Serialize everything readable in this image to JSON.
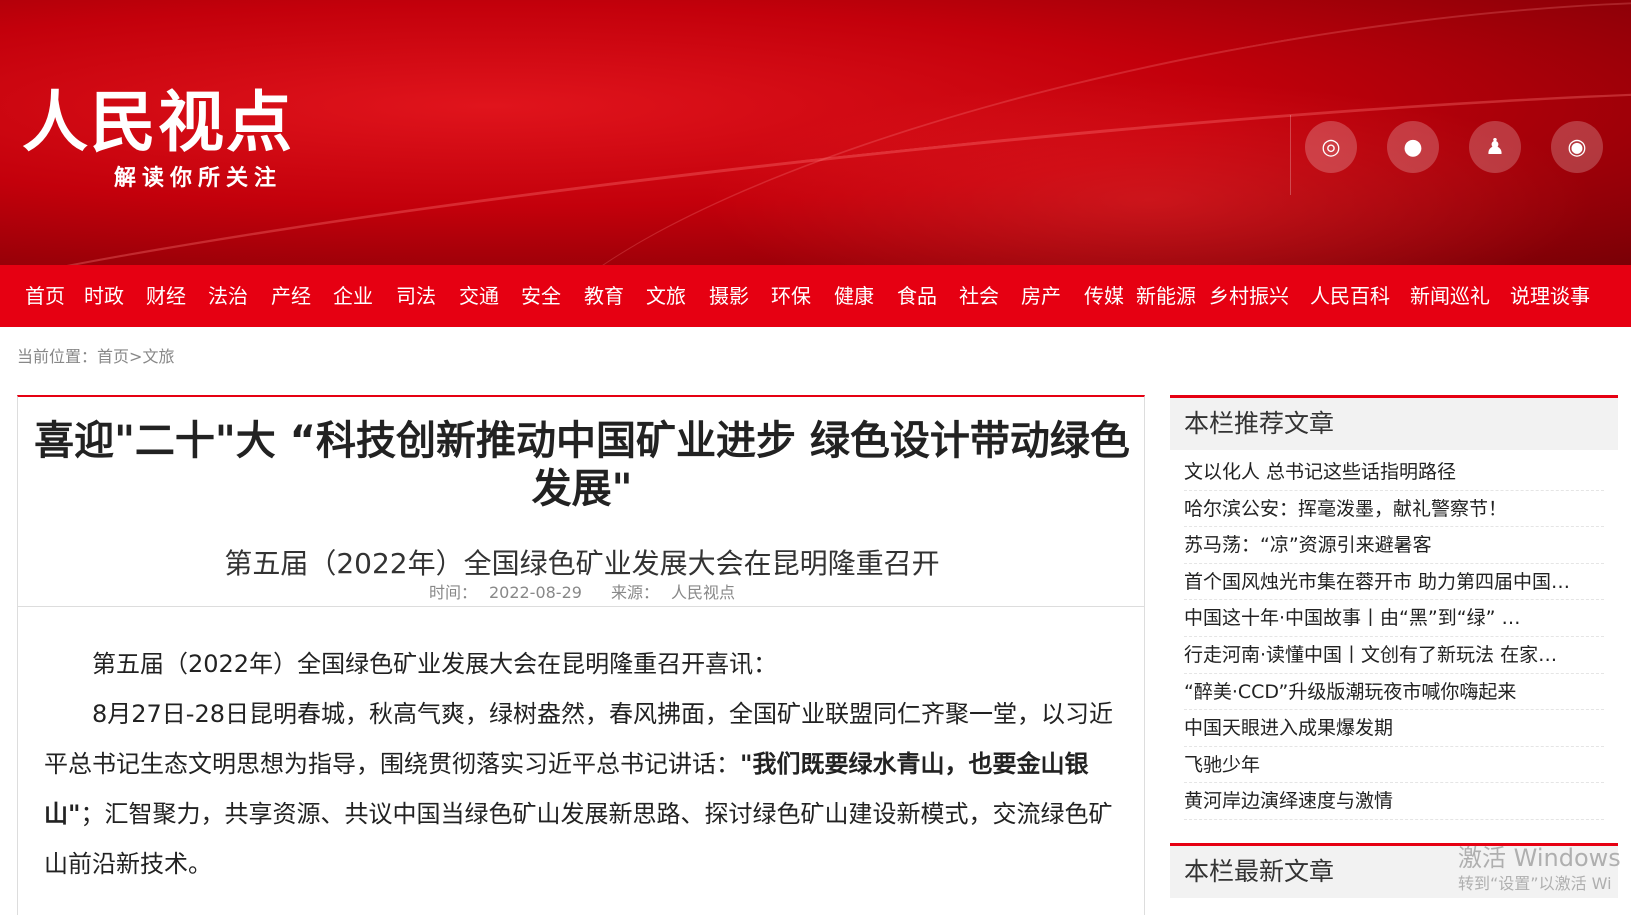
{
  "header": {
    "brand": "人民视点",
    "slogan": "解读你所关注",
    "social": [
      {
        "icon": "weibo-icon",
        "glyph": "◎"
      },
      {
        "icon": "wechat-icon",
        "glyph": "●"
      },
      {
        "icon": "qq-icon",
        "glyph": "♟"
      },
      {
        "icon": "app-icon",
        "glyph": "◉"
      }
    ]
  },
  "nav": [
    "首页",
    "时政",
    "财经",
    "法治",
    "产经",
    "企业",
    "司法",
    "交通",
    "安全",
    "教育",
    "文旅",
    "摄影",
    "环保",
    "健康",
    "食品",
    "社会",
    "房产",
    "传媒",
    "新能源",
    "乡村振兴",
    "人民百科",
    "新闻巡礼",
    "说理谈事"
  ],
  "breadcrumb": {
    "prefix": "当前位置：",
    "home": "首页",
    "sep": ">",
    "current": "文旅"
  },
  "article": {
    "title": "喜迎\"二十\"大 “科技创新推动中国矿业进步 绿色设计带动绿色发展\"",
    "subtitle": "第五届（2022年）全国绿色矿业发展大会在昆明隆重召开",
    "time_label": "时间：",
    "time": "2022-08-29",
    "source_label": "来源：",
    "source": "人民视点",
    "p1": "第五届（2022年）全国绿色矿业发展大会在昆明隆重召开喜讯：",
    "p2_a": "8月27日-28日昆明春城，秋高气爽，绿树盎然，春风拂面，全国矿业联盟同仁齐聚一堂，以习近平总书记生态文明思想为指导，围绕贯彻落实习近平总书记讲话：",
    "p2_bold": "\"我们既要绿水青山，也要金山银山\"",
    "p2_b": "；汇智聚力，共享资源、共议中国当绿色矿山发展新思路、探讨绿色矿山建设新模式，交流绿色矿山前沿新技术。"
  },
  "sidebar": {
    "recommended_title": "本栏推荐文章",
    "recommended": [
      "文以化人 总书记这些话指明路径",
      "哈尔滨公安：挥毫泼墨，献礼警察节！",
      "苏马荡：“凉”资源引来避暑客",
      "首个国风烛光市集在蓉开市 助力第四届中国…",
      "中国这十年·中国故事丨由“黑”到“绿” …",
      "行走河南·读懂中国丨文创有了新玩法 在家…",
      "“醉美·CCD”升级版潮玩夜市喊你嗨起来",
      "中国天眼进入成果爆发期",
      "飞驰少年",
      "黄河岸边演绎速度与激情"
    ],
    "latest_title": "本栏最新文章"
  },
  "watermark": {
    "line1": "激活 Windows",
    "line2": "转到“设置”以激活 Wi"
  }
}
